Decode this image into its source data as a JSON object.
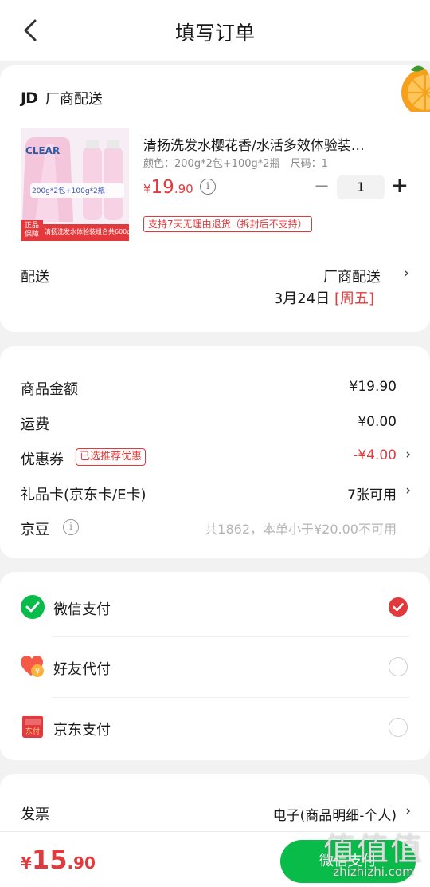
{
  "header": {
    "title": "填写订单"
  },
  "shop": {
    "logo_text": "JD",
    "name": "厂商配送"
  },
  "product": {
    "name": "清扬洗发水樱花香/水活多效体验装…",
    "spec": "颜色：200g*2包+100g*2瓶　尺码：1",
    "price_symbol": "¥",
    "price_int": "19",
    "price_dec": ".90",
    "quantity": "1",
    "minus_label": "−",
    "plus_label": "+",
    "return_policy": "支持7天无理由退货（拆封后不支持）",
    "image": {
      "brand": "CLEAR",
      "badge": "200g*2包+100g*2瓶",
      "guarantee": "正品保障",
      "caption": "清扬洗发水体验装组合共600g"
    }
  },
  "delivery": {
    "label": "配送",
    "method": "厂商配送",
    "date": "3月24日",
    "weekday": "[周五]"
  },
  "summary": {
    "goods_label": "商品金额",
    "goods_value": "¥19.90",
    "freight_label": "运费",
    "freight_value": "¥0.00",
    "coupon_label": "优惠券",
    "coupon_tag": "已选推荐优惠",
    "coupon_value": "-¥4.00",
    "giftcard_label": "礼品卡(京东卡/E卡)",
    "giftcard_value": "7张可用",
    "beans_label": "京豆",
    "beans_note": "共1862，本单小于¥20.00不可用"
  },
  "payment": [
    {
      "label": "微信支付",
      "icon": "wechat-pay-icon",
      "selected": true
    },
    {
      "label": "好友代付",
      "icon": "friend-pay-icon",
      "selected": false
    },
    {
      "label": "京东支付",
      "icon": "jd-pay-icon",
      "selected": false
    }
  ],
  "invoice": {
    "label": "发票",
    "value": "电子(商品明细-个人)"
  },
  "bottom": {
    "total_symbol": "¥",
    "total_int": "15",
    "total_dec": ".90",
    "pay_button": "微信支付"
  },
  "watermark": {
    "glyphs": "值值值",
    "url": "zhizhizhi.com"
  },
  "colors": {
    "accent": "#e4393c",
    "wechat_green": "#09bb49",
    "background": "#f2f2f2"
  }
}
